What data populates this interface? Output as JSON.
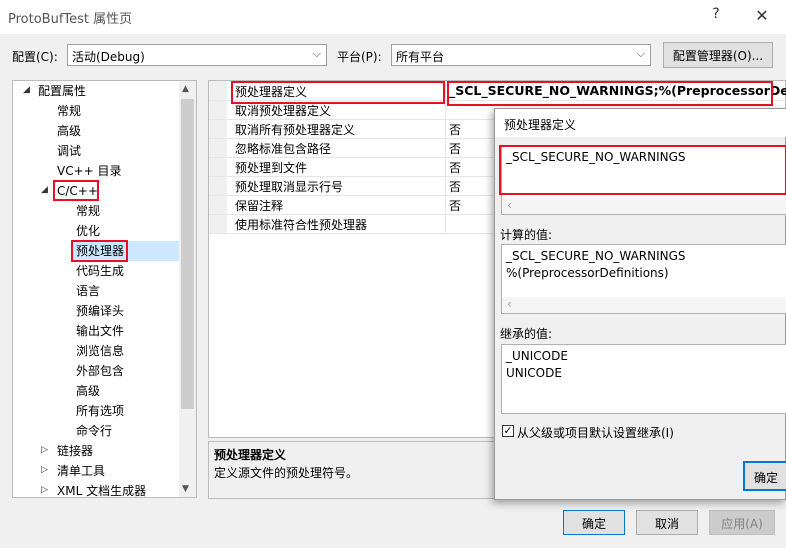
{
  "window": {
    "title": "ProtoBufTest 属性页",
    "help": "?",
    "close": "✕"
  },
  "config": {
    "label": "配置(C):",
    "value": "活动(Debug)"
  },
  "platform": {
    "label": "平台(P):",
    "value": "所有平台"
  },
  "config_manager": "配置管理器(O)...",
  "tree": {
    "root": "配置属性",
    "items": [
      "常规",
      "高级",
      "调试",
      "VC++ 目录"
    ],
    "cpp": "C/C++",
    "cpp_children": [
      "常规",
      "优化",
      "预处理器",
      "代码生成",
      "语言",
      "预编译头",
      "输出文件",
      "浏览信息",
      "外部包含",
      "高级",
      "所有选项",
      "命令行"
    ],
    "after": [
      "链接器",
      "清单工具",
      "XML 文档生成器"
    ]
  },
  "grid": {
    "rows": [
      {
        "name": "预处理器定义",
        "value": "_SCL_SECURE_NO_WARNINGS;%(PreprocessorDefinit"
      },
      {
        "name": "取消预处理器定义",
        "value": ""
      },
      {
        "name": "取消所有预处理器定义",
        "value": "否"
      },
      {
        "name": "忽略标准包含路径",
        "value": "否"
      },
      {
        "name": "预处理到文件",
        "value": "否"
      },
      {
        "name": "预处理取消显示行号",
        "value": "否"
      },
      {
        "name": "保留注释",
        "value": "否"
      },
      {
        "name": "使用标准符合性预处理器",
        "value": ""
      }
    ]
  },
  "description": {
    "title": "预处理器定义",
    "text": "定义源文件的预处理符号。"
  },
  "popup": {
    "title": "预处理器定义",
    "edit_value": "_SCL_SECURE_NO_WARNINGS",
    "computed_label": "计算的值:",
    "computed_lines": [
      "_SCL_SECURE_NO_WARNINGS",
      "%(PreprocessorDefinitions)"
    ],
    "inherited_label": "继承的值:",
    "inherited_lines": [
      "_UNICODE",
      "UNICODE"
    ],
    "inherit_checkbox": "从父级或项目默认设置继承(I)",
    "ok": "确定"
  },
  "buttons": {
    "ok": "确定",
    "cancel": "取消",
    "apply": "应用(A)"
  }
}
